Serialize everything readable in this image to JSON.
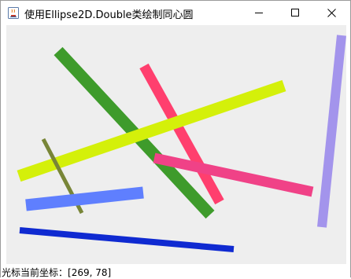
{
  "window": {
    "title": "使用Ellipse2D.Double类绘制同心圆",
    "app_icon": "java-coffee-icon",
    "controls": {
      "minimize_icon": "minimize-icon",
      "maximize_icon": "maximize-icon",
      "close_icon": "close-icon"
    }
  },
  "canvas": {
    "background": "#eeeeee",
    "lines": [
      {
        "color": "#3e9b2b"
      },
      {
        "color": "#ff3f6e"
      },
      {
        "color": "#d4f00a"
      },
      {
        "color": "#f04287"
      },
      {
        "color": "#788537"
      },
      {
        "color": "#5f7ffe"
      },
      {
        "color": "#0f2ad1"
      },
      {
        "color": "#a394ec"
      }
    ]
  },
  "status": {
    "label": "光标当前坐标：",
    "coords": "[269, 78]"
  }
}
